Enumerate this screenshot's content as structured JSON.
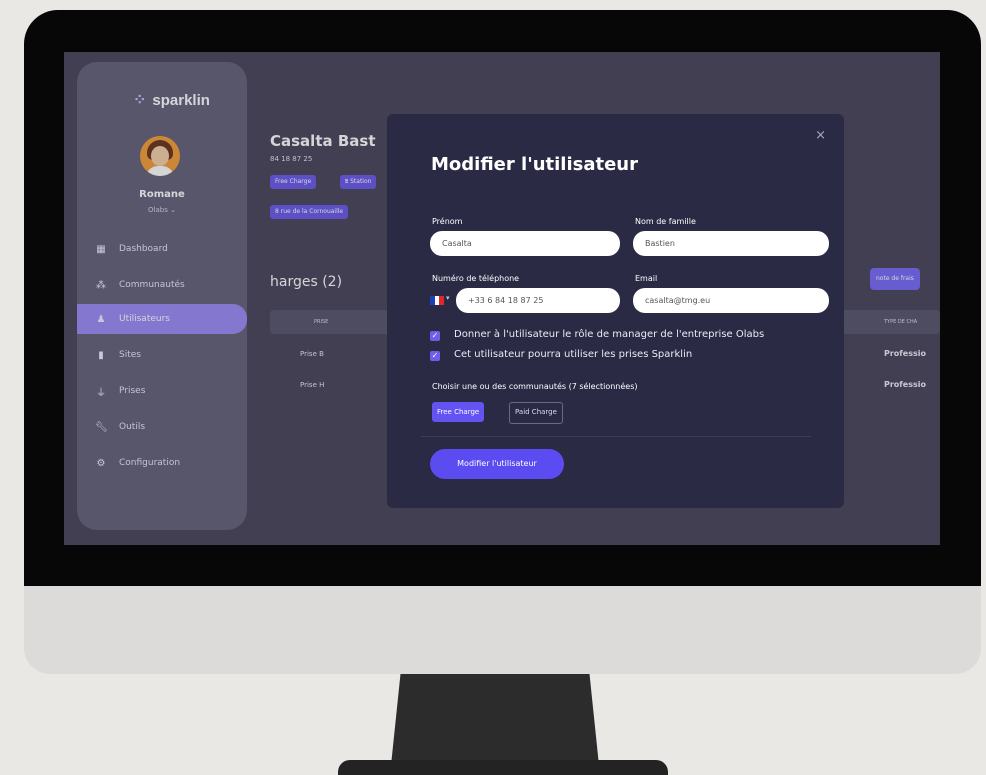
{
  "brand": {
    "name": "sparklin"
  },
  "user": {
    "name": "Romane",
    "org": "Olabs ⌄"
  },
  "sidebar": {
    "items": [
      {
        "label": "Dashboard",
        "icon": "dashboard-icon"
      },
      {
        "label": "Communautés",
        "icon": "communities-icon"
      },
      {
        "label": "Utilisateurs",
        "icon": "user-icon",
        "active": true
      },
      {
        "label": "Sites",
        "icon": "building-icon"
      },
      {
        "label": "Prises",
        "icon": "plug-icon"
      },
      {
        "label": "Outils",
        "icon": "wrench-icon"
      },
      {
        "label": "Configuration",
        "icon": "gear-icon"
      }
    ]
  },
  "main": {
    "title": "Casalta Bast",
    "phone": "84 18 87 25",
    "tags": [
      "Free Charge",
      "⩩ Station"
    ],
    "address_tag": "8 rue de la Cornouaille",
    "section_title": "harges (2)",
    "note_button": "note de frais",
    "table": {
      "headers": {
        "prise": "PRISE",
        "type": "TYPE DE CHA"
      },
      "rows": [
        {
          "prise": "Prise B",
          "type": "Professio"
        },
        {
          "prise": "Prise H",
          "type": "Professio"
        }
      ]
    }
  },
  "modal": {
    "title": "Modifier l'utilisateur",
    "close": "×",
    "first_name": {
      "label": "Prénom",
      "value": "Casalta"
    },
    "last_name": {
      "label": "Nom de famille",
      "value": "Bastien"
    },
    "phone": {
      "label": "Numéro de téléphone",
      "value": "+33 6 84 18 87 25",
      "country": "France"
    },
    "email": {
      "label": "Email",
      "value": "casalta@tmg.eu"
    },
    "checkboxes": [
      {
        "label": "Donner à l'utilisateur le rôle de manager de l'entreprise Olabs",
        "checked": true
      },
      {
        "label": "Cet utilisateur pourra utiliser les prises Sparklin",
        "checked": true
      }
    ],
    "communities_label": "Choisir une ou des communautés (7 sélectionnées)",
    "chips": [
      {
        "label": "Free Charge",
        "selected": true
      },
      {
        "label": "Paid Charge",
        "selected": false
      }
    ],
    "submit": "Modifier l'utilisateur"
  },
  "colors": {
    "accent": "#6453f3",
    "modal_bg": "#2b2a45",
    "sidebar_bg": "#67667a",
    "active_nav": "#9b8ef6"
  }
}
